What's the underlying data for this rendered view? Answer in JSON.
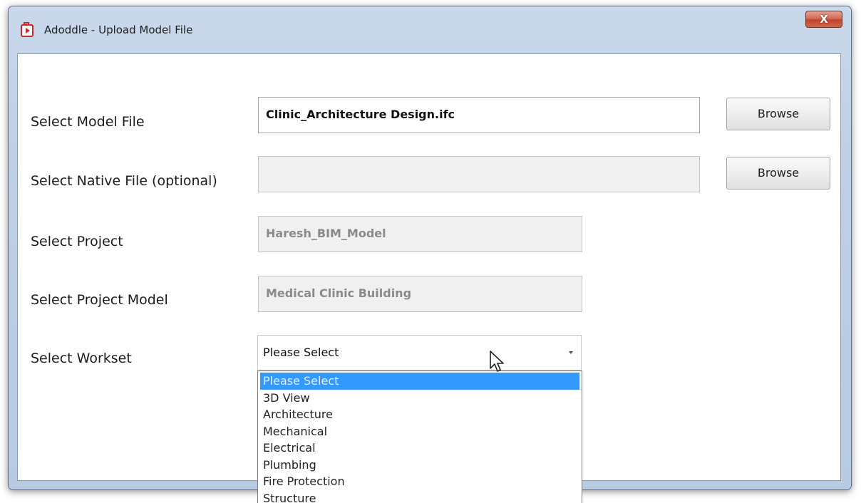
{
  "window": {
    "title": "Adoddle - Upload Model File",
    "close_label": "X"
  },
  "form": {
    "model_file": {
      "label": "Select Model File",
      "value": "Clinic_Architecture Design.ifc",
      "browse_label": "Browse"
    },
    "native_file": {
      "label": "Select Native File (optional)",
      "value": "",
      "browse_label": "Browse"
    },
    "project": {
      "label": "Select Project",
      "value": "Haresh_BIM_Model"
    },
    "project_model": {
      "label": "Select Project Model",
      "value": "Medical Clinic Building"
    },
    "workset": {
      "label": "Select Workset",
      "selected": "Please Select",
      "options": [
        "Please Select",
        "3D View",
        "Architecture",
        "Mechanical",
        "Electrical",
        "Plumbing",
        "Fire Protection",
        "Structure"
      ]
    }
  },
  "colors": {
    "selection_highlight": "#3399ff",
    "close_button": "#c0432c",
    "title_bar": "#bfd0e5"
  }
}
